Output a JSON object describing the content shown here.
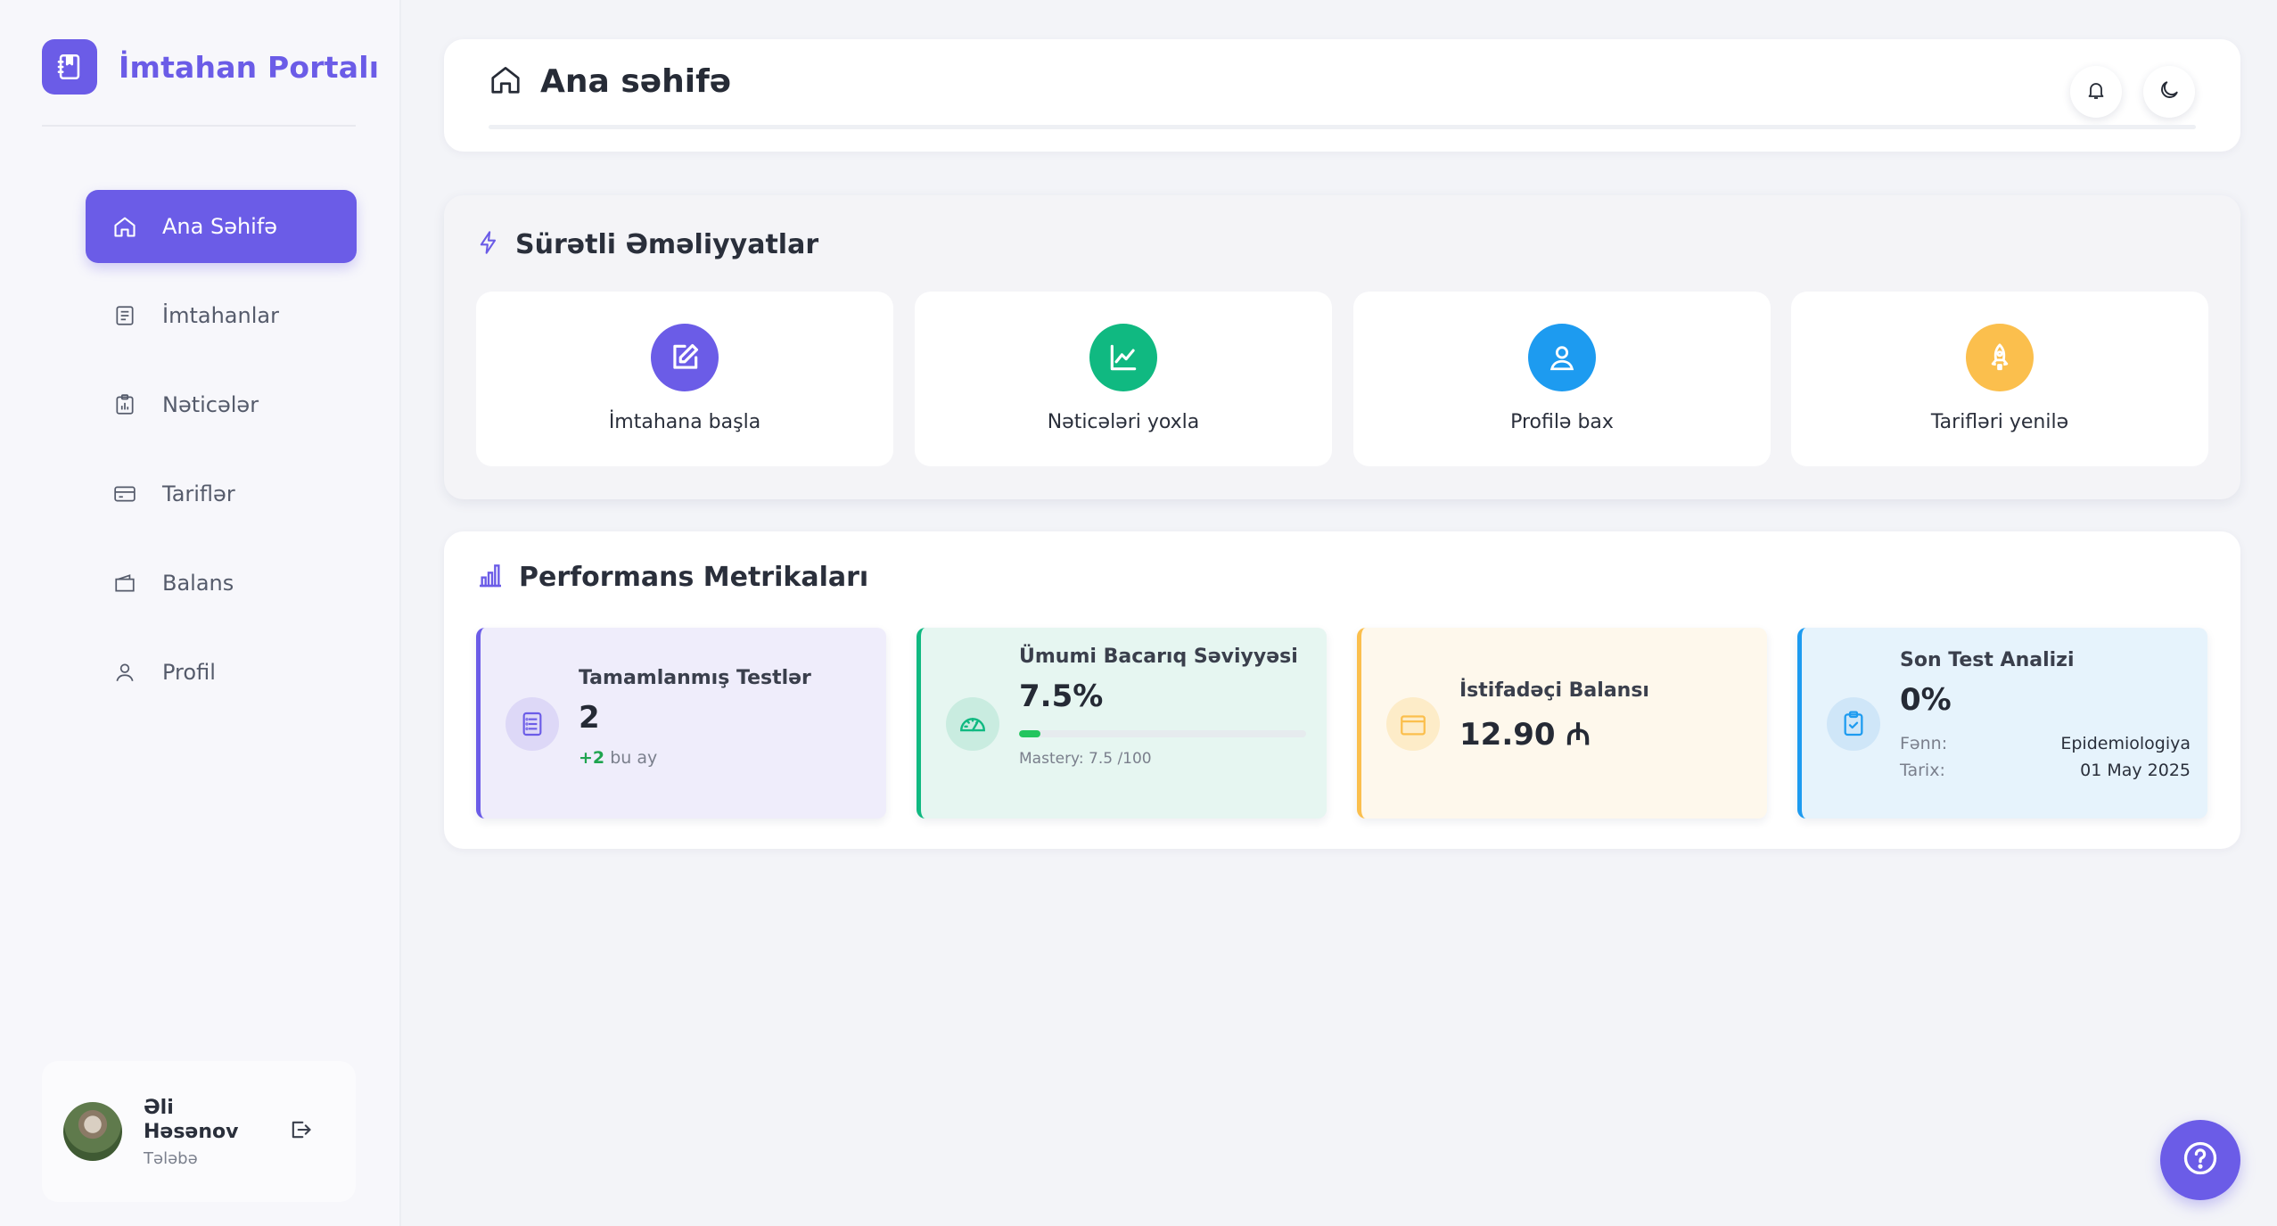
{
  "app": {
    "title": "İmtahan Portalı",
    "accent": "#6b5ce7"
  },
  "sidebar": {
    "items": [
      {
        "label": "Ana Səhifə",
        "icon": "home-icon",
        "active": true
      },
      {
        "label": "İmtahanlar",
        "icon": "document-list-icon"
      },
      {
        "label": "Nəticələr",
        "icon": "clipboard-chart-icon"
      },
      {
        "label": "Tariflər",
        "icon": "credit-card-icon"
      },
      {
        "label": "Balans",
        "icon": "wallet-icon"
      },
      {
        "label": "Profil",
        "icon": "user-icon"
      }
    ],
    "user": {
      "name": "Əli Həsənov",
      "role": "Tələbə"
    }
  },
  "header": {
    "title": "Ana səhifə",
    "icons": [
      "bell-icon",
      "moon-icon"
    ]
  },
  "quick_actions": {
    "title": "Sürətli Əməliyyatlar",
    "items": [
      {
        "label": "İmtahana başla",
        "icon": "edit-icon",
        "color": "#6b5ce7"
      },
      {
        "label": "Nəticələri yoxla",
        "icon": "line-chart-icon",
        "color": "#10b981"
      },
      {
        "label": "Profilə bax",
        "icon": "user-icon",
        "color": "#1d9bf0"
      },
      {
        "label": "Tarifləri yenilə",
        "icon": "rocket-icon",
        "color": "#fbbf4d"
      }
    ]
  },
  "performance": {
    "title": "Performans Metrikaları",
    "completed": {
      "label": "Tamamlanmış Testlər",
      "value": "2",
      "delta": "+2",
      "delta_suffix": "bu ay",
      "color": "#6b5ce7"
    },
    "skill": {
      "label": "Ümumi Bacarıq Səviyyəsi",
      "value": "7.5%",
      "progress": 0.075,
      "mastery": "Mastery: 7.5 /100",
      "color": "#10b981"
    },
    "balance": {
      "label": "İstifadəçi Balansı",
      "value": "12.90 ₼",
      "color": "#fbbf4d"
    },
    "last_test": {
      "label": "Son Test Analizi",
      "value": "0%",
      "subject_key": "Fənn:",
      "subject": "Epidemiologiya",
      "date_key": "Tarix:",
      "date": "01 May 2025",
      "color": "#1d9bf0"
    }
  }
}
